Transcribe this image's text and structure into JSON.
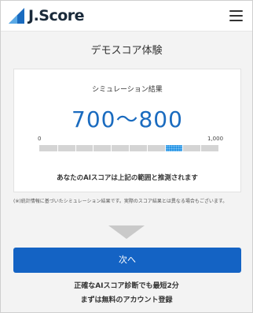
{
  "header": {
    "logo_text": "J.Score",
    "logo_icon": "jscore-logo-icon",
    "menu_icon": "hamburger-menu-icon"
  },
  "page": {
    "title": "デモスコア体験"
  },
  "result": {
    "label": "シミュレーション結果",
    "score_range": "700～800",
    "scale_min": "0",
    "scale_max": "1,000",
    "scale_max_value": 1000,
    "range_low": 700,
    "range_high": 800,
    "note": "あなたのAIスコアは上記の範囲と推測されます"
  },
  "disclaimer": "(※)統計情報に基づいたシミュレーション結果です。実際のスコア結果とは異なる場合もございます。",
  "next_button": {
    "label": "次へ"
  },
  "footer": {
    "line1": "正確なAIスコア診断でも最短2分",
    "line2": "まずは無料のアカウント登録"
  },
  "colors": {
    "accent": "#1463c4",
    "score_text": "#1a6bbf",
    "bar_fill": "#2a96e6",
    "bar_track": "#d4d4d4",
    "logo_blue": "#1a6bbf"
  }
}
